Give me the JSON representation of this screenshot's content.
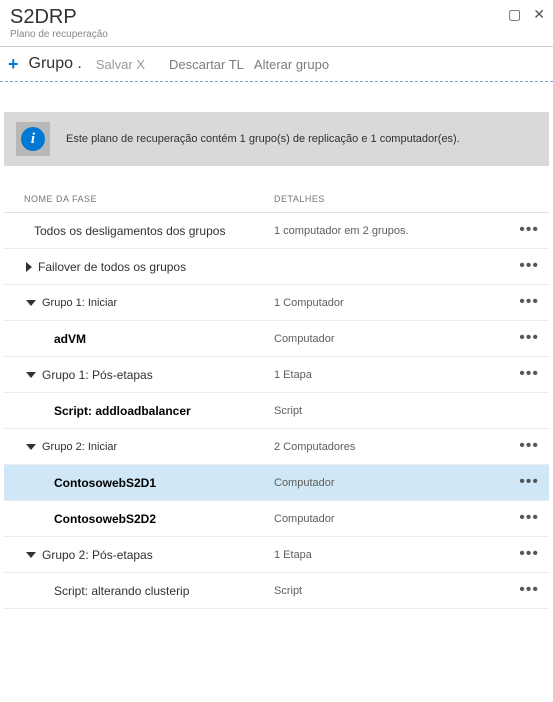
{
  "header": {
    "title": "S2DRP",
    "subtitle": "Plano de recuperação"
  },
  "toolbar": {
    "group_label": "Grupo .",
    "save_label": "Salvar X",
    "discard_label": "Descartar TL",
    "change_group_label": "Alterar grupo"
  },
  "info": {
    "message": "Este plano de recuperação contém 1 grupo(s) de replicação e 1 computador(es)."
  },
  "columns": {
    "name": "NOME DA FASE",
    "details": "DETALHES"
  },
  "rows": [
    {
      "indent": 2,
      "caret": "",
      "name": "Todos os desligamentos dos grupos",
      "detail": "1 computador em 2 grupos.",
      "bold": false,
      "menu": true,
      "sm": false
    },
    {
      "indent": 1,
      "caret": "right",
      "name": "Failover de todos os grupos",
      "detail": "",
      "bold": false,
      "menu": true,
      "sm": false
    },
    {
      "indent": 1,
      "caret": "down",
      "name": "Grupo 1: Iniciar",
      "detail": "1 Computador",
      "bold": false,
      "menu": true,
      "sm": true
    },
    {
      "indent": 3,
      "caret": "",
      "name": "adVM",
      "detail": "Computador",
      "bold": true,
      "menu": true,
      "sm": false
    },
    {
      "indent": 1,
      "caret": "down",
      "name": "Grupo 1: Pós-etapas",
      "detail": "1 Etapa",
      "bold": false,
      "menu": true,
      "sm": false
    },
    {
      "indent": 3,
      "caret": "",
      "name": "Script: addloadbalancer",
      "detail": "Script",
      "bold": true,
      "menu": false,
      "sm": false
    },
    {
      "indent": 1,
      "caret": "down",
      "name": "Grupo 2: Iniciar",
      "detail": "2 Computadores",
      "bold": false,
      "menu": true,
      "sm": true
    },
    {
      "indent": 3,
      "caret": "",
      "name": "ContosowebS2D1",
      "detail": "Computador",
      "bold": true,
      "menu": true,
      "selected": true,
      "sm": false
    },
    {
      "indent": 3,
      "caret": "",
      "name": "ContosowebS2D2",
      "detail": "Computador",
      "bold": true,
      "menu": true,
      "sm": false
    },
    {
      "indent": 1,
      "caret": "down",
      "name": "Grupo 2: Pós-etapas",
      "detail": "1 Etapa",
      "bold": false,
      "menu": true,
      "sm": false
    },
    {
      "indent": 3,
      "caret": "",
      "name": "Script: alterando clusterip",
      "detail": "Script",
      "bold": false,
      "menu": true,
      "sm": false
    }
  ]
}
